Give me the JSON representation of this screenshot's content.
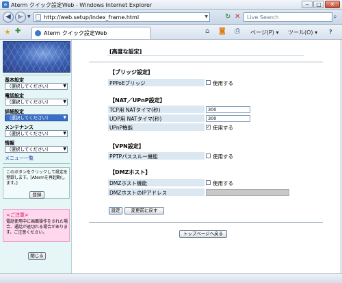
{
  "window": {
    "title": "Aterm クイック設定Web - Windows Internet Explorer",
    "min_glyph": "‒",
    "max_glyph": "□",
    "close_glyph": "✕"
  },
  "address": {
    "url": "http://web.setup/index_frame.html",
    "search_placeholder": "Live Search"
  },
  "tab": {
    "label": "Aterm クイック設定Web"
  },
  "commands": {
    "page": "ページ(P)",
    "tools": "ツール(O)",
    "help": "?"
  },
  "sidebar": {
    "categories": [
      {
        "label": "基本設定",
        "selected": "（選択してください）"
      },
      {
        "label": "電話設定",
        "selected": "（選択してください）"
      },
      {
        "label": "詳細設定",
        "selected": "（選択してください）"
      },
      {
        "label": "メンテナンス",
        "selected": "（選択してください）"
      },
      {
        "label": "情報",
        "selected": "（選択してください）"
      }
    ],
    "menu_list": "メニュー一覧",
    "note": "このボタンをクリックして設定を登録します。[Atermを再起動します。]",
    "register_button": "登録",
    "caution_title": "<ご注意>",
    "caution_text": "電話使用中に画面操作をされた場合、通話が途切れる場合があります。ご注意ください。",
    "close_button": "閉じる"
  },
  "main": {
    "page_title": "[高度な設定]",
    "sections": [
      {
        "title": "【ブリッジ設定】",
        "rows": [
          {
            "label": "PPPoEブリッジ",
            "checkbox_label": "使用する",
            "checked": false
          }
        ]
      },
      {
        "title": "【NAT／UPnP設定】",
        "rows": [
          {
            "label": "TCP用 NATタイマ(秒)",
            "value": "300"
          },
          {
            "label": "UDP用 NATタイマ(秒)",
            "value": "300"
          },
          {
            "label": "UPnP機能",
            "checkbox_label": "使用する",
            "checked": true
          }
        ]
      },
      {
        "title": "【VPN設定】",
        "rows": [
          {
            "label": "PPTPパススルー機能",
            "checkbox_label": "使用する",
            "checked": false
          }
        ]
      },
      {
        "title": "【DMZホスト】",
        "rows": [
          {
            "label": "DMZホスト機能",
            "checkbox_label": "使用する",
            "checked": false
          },
          {
            "label": "DMZホストのIPアドレス",
            "value": ""
          }
        ]
      }
    ],
    "apply_button": "設定",
    "restore_button": "変更前に戻す",
    "top_button": "トップページへ戻る"
  }
}
